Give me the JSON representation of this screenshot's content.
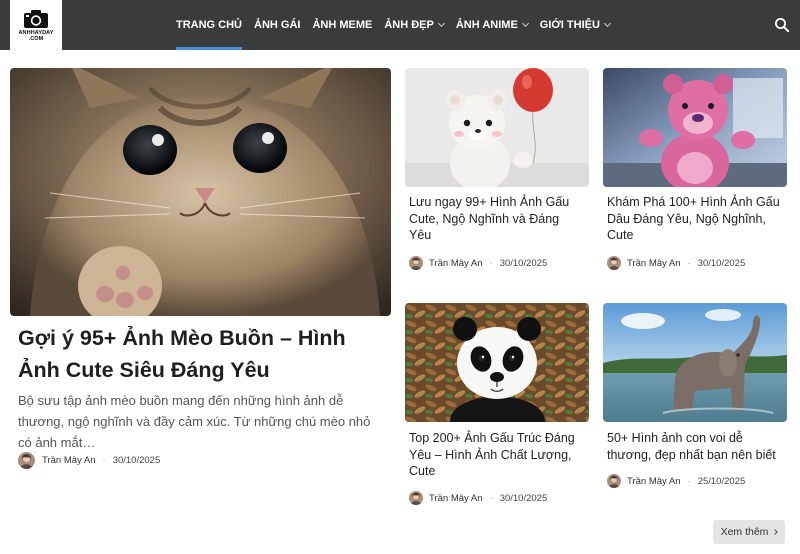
{
  "header": {
    "logo_line1": "ANHHAYDAY",
    "logo_line2": ".COM",
    "nav": [
      {
        "label": "TRANG CHỦ",
        "active": true,
        "dropdown": false
      },
      {
        "label": "ẢNH GÁI",
        "active": false,
        "dropdown": false
      },
      {
        "label": "ẢNH MEME",
        "active": false,
        "dropdown": false
      },
      {
        "label": "ẢNH ĐẸP",
        "active": false,
        "dropdown": true
      },
      {
        "label": "ẢNH ANIME",
        "active": false,
        "dropdown": true
      },
      {
        "label": "GIỚI THIỆU",
        "active": false,
        "dropdown": true
      }
    ],
    "search_icon": "search-icon"
  },
  "posts": [
    {
      "title": "Gợi ý 95+ Ảnh Mèo Buồn – Hình Ảnh Cute Siêu Đáng Yêu",
      "excerpt": "Bộ sưu tập ảnh mèo buồn mang đến những hình ảnh dễ thương, ngộ nghĩnh và đầy cảm xúc. Từ những chú mèo nhỏ có ảnh mắt…",
      "author": "Trần Mây An",
      "date": "30/10/2025"
    },
    {
      "title": "Lưu ngay 99+ Hình Ảnh Gấu Cute, Ngộ Nghĩnh và Đáng Yêu",
      "author": "Trần Mây An",
      "date": "30/10/2025"
    },
    {
      "title": "Khám Phá 100+ Hình Ảnh Gấu Dâu Đáng Yêu, Ngộ Nghĩnh, Cute",
      "author": "Trần Mây An",
      "date": "30/10/2025"
    },
    {
      "title": "Top 200+ Ảnh Gấu Trúc Đáng Yêu – Hình Ảnh Chất Lượng, Cute",
      "author": "Trần Mây An",
      "date": "30/10/2025"
    },
    {
      "title": "50+ Hình ảnh con voi dễ thương, đẹp nhất bạn nên biết",
      "author": "Trần Mây An",
      "date": "25/10/2025"
    }
  ],
  "pagination": {
    "more_label": "Xem thêm"
  },
  "colors": {
    "header_bg": "#3a3b3d",
    "nav_active_underline": "#4a90d9",
    "more_button_bg": "#e4e4e4"
  }
}
